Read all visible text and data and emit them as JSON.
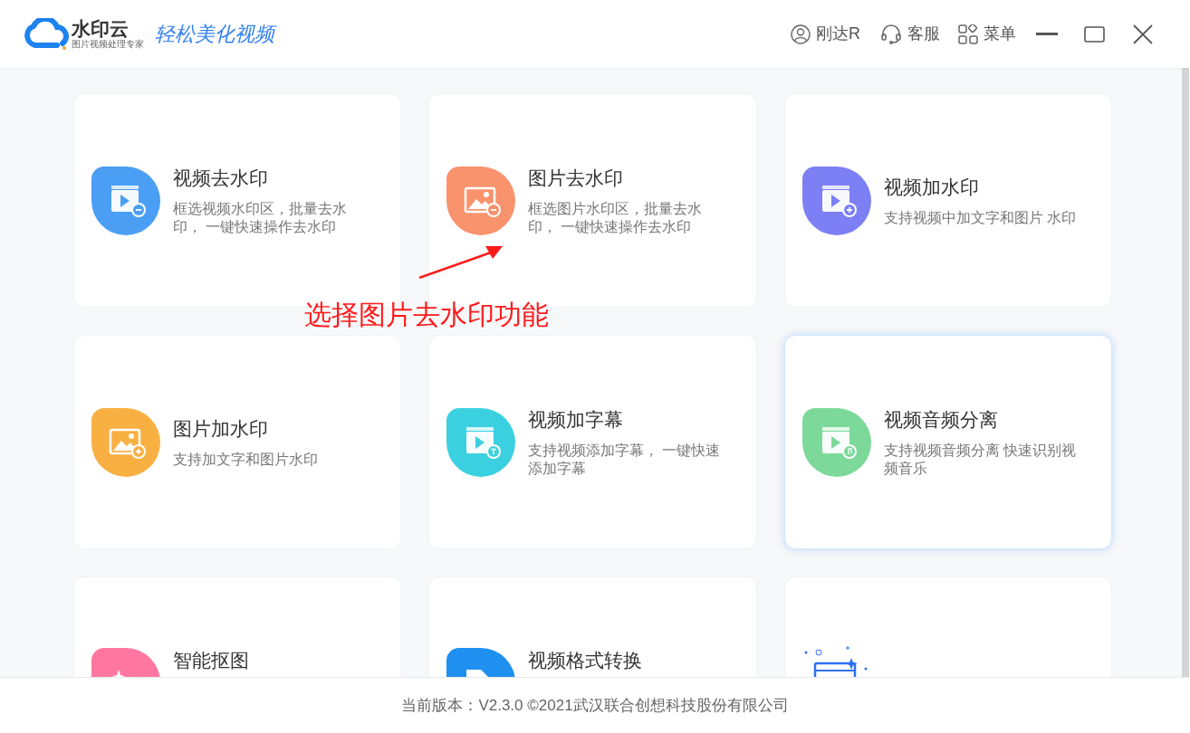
{
  "app": {
    "name": "水印云",
    "subtitle": "图片视频处理专家",
    "slogan": "轻松美化视频"
  },
  "header": {
    "user": "刚达R",
    "service": "客服",
    "menu": "菜单"
  },
  "cards": [
    {
      "title": "视频去水印",
      "desc": "框选视频水印区，批量去水印， 一键快速操作去水印",
      "color": "#4a9ff5",
      "selected": false
    },
    {
      "title": "图片去水印",
      "desc": "框选图片水印区，批量去水印， 一键快速操作去水印",
      "color": "#f9936e",
      "selected": false
    },
    {
      "title": "视频加水印",
      "desc": "支持视频中加文字和图片 水印",
      "color": "#7c80f4",
      "selected": false
    },
    {
      "title": "图片加水印",
      "desc": "支持加文字和图片水印",
      "color": "#f8b043",
      "selected": false
    },
    {
      "title": "视频加字幕",
      "desc": "支持视频添加字幕， 一键快速添加字幕",
      "color": "#3bd0df",
      "selected": false
    },
    {
      "title": "视频音频分离",
      "desc": "支持视频音频分离 快速识别视频音乐",
      "color": "#7cd99a",
      "selected": true
    },
    {
      "title": "智能抠图",
      "color": "#ff77a0",
      "selected": false
    },
    {
      "title": "视频格式转换",
      "color": "#1f8ff0",
      "selected": false
    },
    {
      "color": "#2f6ff0",
      "selected": false
    }
  ],
  "annotation": "选择图片去水印功能",
  "footer": "当前版本：V2.3.0 ©2021武汉联合创想科技股份有限公司"
}
